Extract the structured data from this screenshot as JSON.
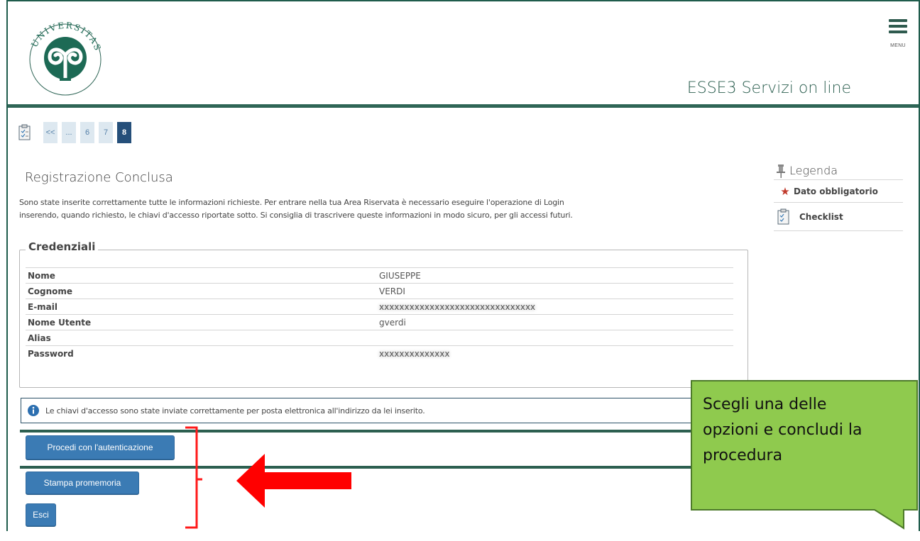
{
  "header": {
    "logo_text_top": "UDIORUM",
    "logo_text_left": "ITAS STUDI",
    "logo_text_bottom": "UNI",
    "site_title": "ESSE3 Servizi on line",
    "menu_label": "MENU",
    "brand_color": "#2e6556"
  },
  "pager": {
    "items": [
      "<<",
      "...",
      "6",
      "7",
      "8"
    ],
    "active": "8"
  },
  "page": {
    "title": "Registrazione Conclusa",
    "intro_line1": "Sono state inserite correttamente tutte le informazioni richieste. Per entrare nella tua Area Riservata è necessario eseguire l'operazione di Login",
    "intro_line2": "inserendo, quando richiesto, le chiavi d'accesso riportate sotto. Si consiglia di trascrivere queste informazioni in modo sicuro, per gli accessi futuri."
  },
  "credentials": {
    "legend": "Credenziali",
    "rows": [
      {
        "label": "Nome",
        "value": "GIUSEPPE"
      },
      {
        "label": "Cognome",
        "value": "VERDI"
      },
      {
        "label": "E-mail",
        "value": "xxxxxxxxxxxxxxxxxxxxxxxxxxxxxxx"
      },
      {
        "label": "Nome Utente",
        "value": "gverdi"
      },
      {
        "label": "Alias",
        "value": ""
      },
      {
        "label": "Password",
        "value": "xxxxxxxxxxxxxx"
      }
    ]
  },
  "info": {
    "message": "Le chiavi d'accesso sono state inviate correttamente per posta elettronica all'indirizzo da lei inserito."
  },
  "actions": {
    "authenticate": "Procedi con l'autenticazione",
    "print": "Stampa promemoria",
    "exit": "Esci"
  },
  "sidebar": {
    "title": "Legenda",
    "items": [
      {
        "icon": "star-icon",
        "label": "Dato obbligatorio"
      },
      {
        "icon": "checklist-icon",
        "label": "Checklist"
      }
    ]
  },
  "callout": {
    "line1": "Scegli una delle",
    "line2": "opzioni e concludi la",
    "line3": "procedura",
    "fill_color": "#92d050"
  },
  "annotation": {
    "arrow_color": "#ff0000",
    "bracket_color": "#ff0000"
  }
}
